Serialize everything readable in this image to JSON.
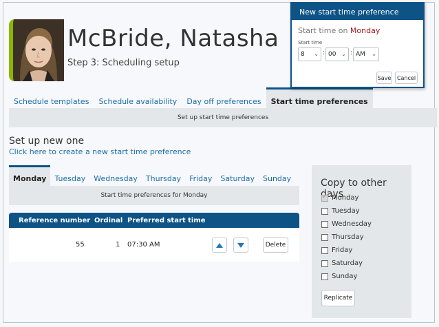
{
  "header": {
    "name": "McBride, Natasha",
    "step": "Step 3: Scheduling setup"
  },
  "tabs": [
    {
      "label": "Schedule templates",
      "active": false
    },
    {
      "label": "Schedule availability",
      "active": false
    },
    {
      "label": "Day off preferences",
      "active": false
    },
    {
      "label": "Start time preferences",
      "active": true
    }
  ],
  "subbar": "Set up start time preferences",
  "setup": {
    "title": "Set up new one",
    "link": "Click here to create a new start time preference"
  },
  "day_tabs": [
    {
      "label": "Monday",
      "active": true
    },
    {
      "label": "Tuesday",
      "active": false
    },
    {
      "label": "Wednesday",
      "active": false
    },
    {
      "label": "Thursday",
      "active": false
    },
    {
      "label": "Friday",
      "active": false
    },
    {
      "label": "Saturday",
      "active": false
    },
    {
      "label": "Sunday",
      "active": false
    }
  ],
  "day_bar": "Start time preferences for Monday",
  "table": {
    "headers": [
      "Reference number",
      "Ordinal",
      "Preferred start time"
    ],
    "rows": [
      {
        "reference": "55",
        "ordinal": "1",
        "start_time": "07:30 AM",
        "delete_label": "Delete"
      }
    ]
  },
  "copy_panel": {
    "title": "Copy to other days",
    "days": [
      {
        "label": "Monday",
        "checked": true
      },
      {
        "label": "Tuesday",
        "checked": false
      },
      {
        "label": "Wednesday",
        "checked": false
      },
      {
        "label": "Thursday",
        "checked": false
      },
      {
        "label": "Friday",
        "checked": false
      },
      {
        "label": "Saturday",
        "checked": false
      },
      {
        "label": "Sunday",
        "checked": false
      }
    ],
    "button": "Replicate"
  },
  "popup": {
    "title": "New start time preference",
    "subtitle_prefix": "Start time on",
    "subtitle_day": "Monday",
    "field_label": "Start time",
    "hour": "8",
    "minute": "00",
    "ampm": "AM",
    "colon": ":",
    "save": "Save",
    "cancel": "Cancel"
  },
  "colors": {
    "accent": "#0d5386",
    "link": "#1a6ea8",
    "avatar_border": "#8cb400",
    "day_highlight": "#a01818"
  },
  "icons": {
    "move_up": "triangle-up",
    "move_down": "triangle-down"
  }
}
